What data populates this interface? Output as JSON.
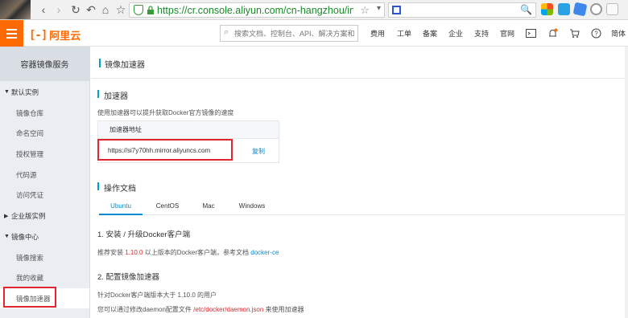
{
  "browser": {
    "url": "https://cr.console.aliyun.com/cn-hangzhou/instan",
    "nav_icons": [
      "back-icon",
      "forward-icon",
      "reload-icon",
      "undo-icon",
      "home-icon",
      "star-icon"
    ],
    "back_glyph": "‹",
    "forward_glyph": "›",
    "reload_glyph": "↻",
    "undo_glyph": "↶",
    "home_glyph": "⌂",
    "star_glyph": "☆",
    "bookmark_glyph": "☆",
    "dropdown_glyph": "▾",
    "search_glyph": "🔍",
    "extension_colors": [
      "#2aa2e6",
      "#3f87e8",
      "#1a6fdc"
    ]
  },
  "topnav": {
    "logo_mark": "[-]",
    "logo_name": "阿里云",
    "search_placeholder": "搜索文档、控制台、API、解决方案和资源",
    "links": [
      "费用",
      "工单",
      "备案",
      "企业",
      "支持",
      "官网"
    ],
    "lang": "简体",
    "icons": [
      "terminal-icon",
      "bell-icon",
      "cart-icon",
      "help-icon"
    ],
    "notify_color": "#ff6a00"
  },
  "sidebar": {
    "title": "容器镜像服务",
    "group_default": "默认实例",
    "default_items": [
      "镜像仓库",
      "命名空间",
      "授权管理",
      "代码源",
      "访问凭证"
    ],
    "group_enterprise": "企业版实例",
    "group_center": "镜像中心",
    "center_items": [
      "镜像搜索",
      "我的收藏",
      "镜像加速器"
    ],
    "expanded_glyph": "▼",
    "collapsed_glyph": "▶"
  },
  "main": {
    "page_title": "镜像加速器",
    "accel_section_title": "加速器",
    "accel_desc": "使用加速器可以提升获取Docker官方镜像的速度",
    "table_header": "加速器地址",
    "accel_address": "https://si7y70hh.mirror.aliyuncs.com",
    "copy_label": "复制",
    "docs_section_title": "操作文档",
    "tabs": [
      "Ubuntu",
      "CentOS",
      "Mac",
      "Windows"
    ],
    "step1_title": "1. 安装 / 升级Docker客户端",
    "step1_pre": "推荐安装 ",
    "step1_version": "1.10.0",
    "step1_mid": " 以上版本的Docker客户端，参考文档 ",
    "step1_link": "docker-ce",
    "step2_title": "2. 配置镜像加速器",
    "step2_line1": "针对Docker客户端版本大于 1.10.0 的用户",
    "step2_pre": "您可以通过修改daemon配置文件 ",
    "step2_path": "/etc/docker/daemon.json",
    "step2_post": " 来使用加速器"
  },
  "colors": {
    "brand": "#ff6a00",
    "accent": "#00a2ca",
    "link": "#0b8bd0",
    "highlight_box": "#e0262f"
  }
}
